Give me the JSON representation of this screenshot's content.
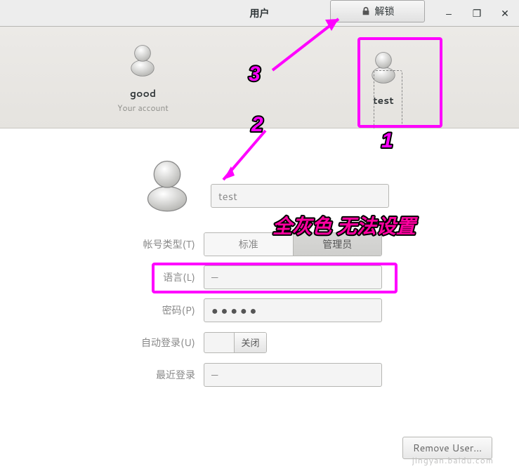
{
  "titlebar": {
    "title": "用户",
    "unlock_label": "解锁"
  },
  "win_controls": {
    "minimize": "–",
    "maximize": "❐",
    "close": "✕"
  },
  "users": {
    "current": {
      "name": "good",
      "subtitle": "Your account"
    },
    "selected": {
      "name": "test"
    }
  },
  "detail": {
    "name_value": "test",
    "labels": {
      "account_type": "帐号类型(T)",
      "language": "语言(L)",
      "password": "密码(P)",
      "auto_login": "自动登录(U)",
      "last_login": "最近登录"
    },
    "account_type_options": {
      "standard": "标准",
      "admin": "管理员"
    },
    "language_value": "—",
    "password_value": "●●●●●",
    "switch_off_label": "关闭",
    "last_login_value": "—",
    "remove_user_label": "Remove User..."
  },
  "annotations": {
    "n1": "1",
    "n2": "2",
    "n3": "3",
    "note": "全灰色 无法设置"
  },
  "watermark": "jingyan.baidu.com"
}
